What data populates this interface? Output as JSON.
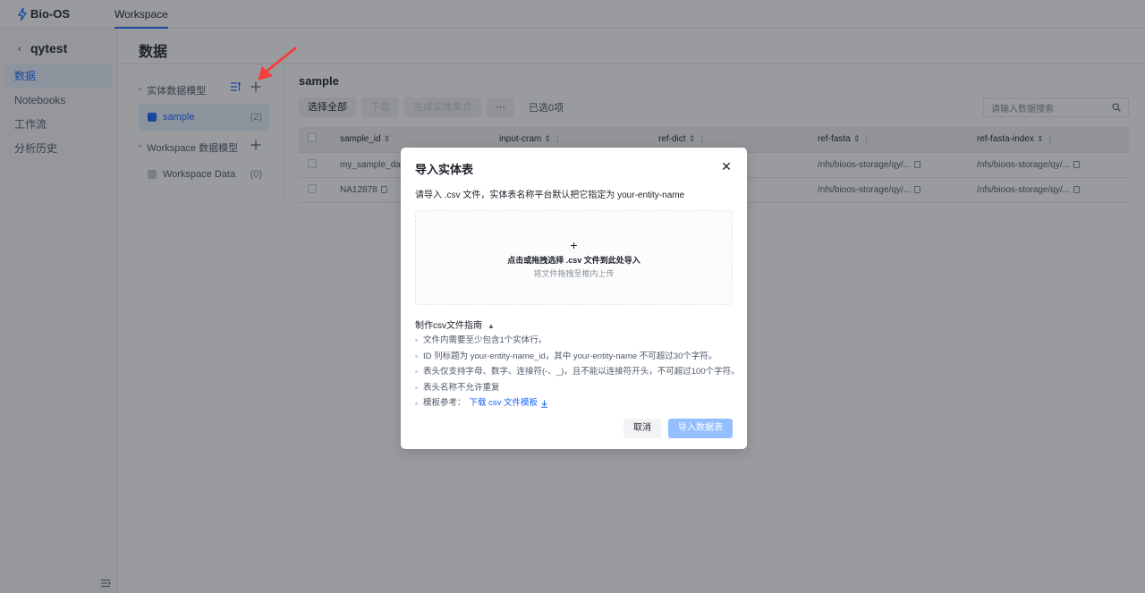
{
  "app": {
    "brand": "Bio-OS",
    "top_tab": "Workspace"
  },
  "sidebar": {
    "project_name": "qytest",
    "items": [
      {
        "label": "数据",
        "active": true
      },
      {
        "label": "Notebooks",
        "active": false
      },
      {
        "label": "工作流",
        "active": false
      },
      {
        "label": "分析历史",
        "active": false
      }
    ]
  },
  "page": {
    "title": "数据"
  },
  "tree": {
    "entity_group": "实体数据模型",
    "workspace_group": "Workspace 数据模型",
    "entity_items": [
      {
        "label": "sample",
        "count": "(2)"
      }
    ],
    "workspace_items": [
      {
        "label": "Workspace Data",
        "count": "(0)"
      }
    ]
  },
  "entity": {
    "title": "sample",
    "toolbar": {
      "select_all": "选择全部",
      "download": "下载",
      "generate": "生成实体集合",
      "more": "···",
      "selected": "已选0项"
    },
    "search_placeholder": "请输入数据搜索",
    "columns": [
      "sample_id",
      "input-cram",
      "ref-dict",
      "ref-fasta",
      "ref-fasta-index"
    ],
    "rows": [
      [
        "my_sample_data",
        "",
        "",
        "/nfs/bioos-storage/qy/...",
        "/nfs/bioos-storage/qy/..."
      ],
      [
        "NA12878",
        "",
        "",
        "/nfs/bioos-storage/qy/...",
        "/nfs/bioos-storage/qy/..."
      ]
    ]
  },
  "modal": {
    "title": "导入实体表",
    "description": "请导入 .csv 文件，实体表名称平台默认把它指定为 your-entity-name",
    "drop_main": "点击或拖拽选择 .csv 文件到此处导入",
    "drop_sub": "将文件拖拽至框内上传",
    "guide_title": "制作csv文件指南",
    "guide_items": [
      "文件内需要至少包含1个实体行。",
      "ID 列标题为 your-entity-name_id，其中 your-entity-name 不可超过30个字符。",
      "表头仅支持字母、数字、连接符(-、_)，且不能以连接符开头，不可超过100个字符。",
      "表头名称不允许重复"
    ],
    "template_label": "模板参考：",
    "template_link": "下载 csv 文件模板",
    "cancel": "取消",
    "submit": "导入数据表"
  },
  "colors": {
    "accent": "#1664ff",
    "annotation_arrow": "#f53f3f"
  }
}
